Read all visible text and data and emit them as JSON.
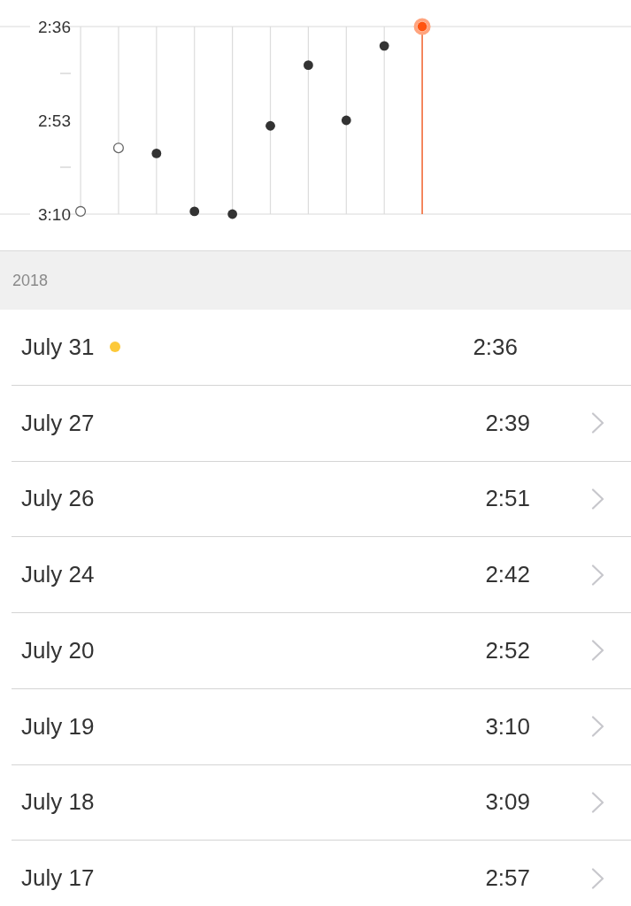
{
  "chart": {
    "chart_data": {
      "type": "scatter",
      "categories": [
        null,
        null,
        null,
        null,
        null,
        null,
        null,
        null,
        null,
        null,
        null,
        null,
        null,
        null,
        null
      ],
      "values": [
        189.5,
        178,
        179,
        189.5,
        190,
        174,
        163,
        173,
        159.5,
        156,
        null,
        null,
        null,
        null,
        null
      ],
      "ylim": [
        190,
        156
      ],
      "yticks": [
        {
          "value": 156,
          "label": "2:36"
        },
        {
          "value": 173,
          "label": "2:53"
        },
        {
          "value": 190,
          "label": "3:10"
        }
      ],
      "grid": true
    },
    "markers": [
      {
        "kind": "hollow",
        "selected": false
      },
      {
        "kind": "hollow",
        "selected": false
      },
      {
        "kind": "filled",
        "selected": false
      },
      {
        "kind": "filled",
        "selected": false
      },
      {
        "kind": "filled",
        "selected": false
      },
      {
        "kind": "filled",
        "selected": false
      },
      {
        "kind": "filled",
        "selected": false
      },
      {
        "kind": "filled",
        "selected": false
      },
      {
        "kind": "filled",
        "selected": false
      },
      {
        "kind": "filled",
        "selected": true
      }
    ]
  },
  "section": {
    "title": "2018"
  },
  "rows": [
    {
      "date": "July 31",
      "dot": true,
      "time": "2:36",
      "chevron": false
    },
    {
      "date": "July 27",
      "dot": false,
      "time": "2:39",
      "chevron": true
    },
    {
      "date": "July 26",
      "dot": false,
      "time": "2:51",
      "chevron": true
    },
    {
      "date": "July 24",
      "dot": false,
      "time": "2:42",
      "chevron": true
    },
    {
      "date": "July 20",
      "dot": false,
      "time": "2:52",
      "chevron": true
    },
    {
      "date": "July 19",
      "dot": false,
      "time": "3:10",
      "chevron": true
    },
    {
      "date": "July 18",
      "dot": false,
      "time": "3:09",
      "chevron": true
    },
    {
      "date": "July 17",
      "dot": false,
      "time": "2:57",
      "chevron": true
    }
  ]
}
